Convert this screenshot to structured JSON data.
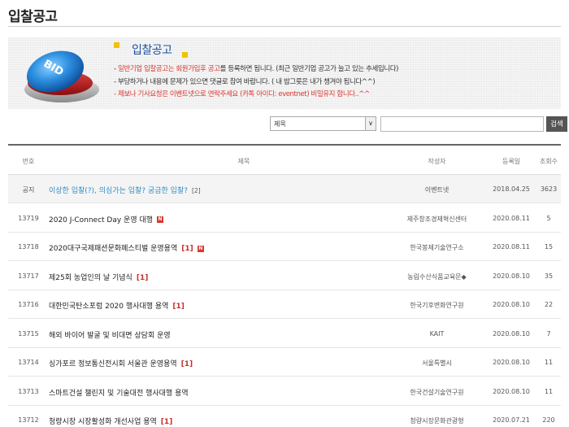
{
  "page": {
    "title": "입찰공고"
  },
  "banner": {
    "title": "입찰공고",
    "art_text": "BID",
    "line1": {
      "prefix": "- ",
      "highlight": "일반기업 입찰공고는 회원가입후 공고",
      "rest": "를 등록하면 됩니다. (최근 일반기업 공고가 늘고 있는 추세입니다)"
    },
    "line2": "- 부당하거나 내용에 문제가 있으면 댓글로 참여 바랍니다. ( 내 밥그릇은 내가 챙겨야 됩니다^^)",
    "line3": "- 제보나 기사요청은 이벤트넷으로 연락주세요 (카톡 아이디: eventnet) 비밀유지 합니다..^^"
  },
  "search": {
    "select_value": "제목",
    "arrow": "∨",
    "input_value": "",
    "button_label": "검색"
  },
  "table": {
    "headers": {
      "no": "번호",
      "title": "제목",
      "writer": "작성자",
      "date": "등록일",
      "views": "조회수"
    },
    "notice": {
      "no": "공지",
      "title": "이상한 입찰(?), 의심가는 입찰? 궁금한 입찰?",
      "comments": "[2]",
      "writer": "이벤트넷",
      "date": "2018.04.25",
      "views": "3623"
    },
    "rows": [
      {
        "no": "13719",
        "title": "2020 J-Connect Day 운영 대행",
        "comments": "",
        "new": "N",
        "writer": "제주창조경제혁신센터",
        "date": "2020.08.11",
        "views": "5"
      },
      {
        "no": "13718",
        "title": "2020대구국제패션문화페스티벌 운영용역",
        "comments": "[1]",
        "new": "N",
        "writer": "한국봉제기술연구소",
        "date": "2020.08.11",
        "views": "15"
      },
      {
        "no": "13717",
        "title": "제25회 농업인의 날 기념식",
        "comments": "[1]",
        "new": "",
        "writer": "농림수산식품교육문◆",
        "date": "2020.08.10",
        "views": "35"
      },
      {
        "no": "13716",
        "title": "대한민국탄소포럼 2020 행사대행 용역",
        "comments": "[1]",
        "new": "",
        "writer": "한국기후변화연구원",
        "date": "2020.08.10",
        "views": "22"
      },
      {
        "no": "13715",
        "title": "해외 바이어 발굴 및 비대면 상담회 운영",
        "comments": "",
        "new": "",
        "writer": "KAIT",
        "date": "2020.08.10",
        "views": "7"
      },
      {
        "no": "13714",
        "title": "싱가포르 정보통신전시회 서울관 운영용역",
        "comments": "[1]",
        "new": "",
        "writer": "서울특별시",
        "date": "2020.08.10",
        "views": "11"
      },
      {
        "no": "13713",
        "title": "스마트건설 챌린지 및 기술대전 행사대행 용역",
        "comments": "",
        "new": "",
        "writer": "한국건설기술연구원",
        "date": "2020.08.10",
        "views": "11"
      },
      {
        "no": "13712",
        "title": "청량시장 시장활성화 개선사업 용역",
        "comments": "[1]",
        "new": "",
        "writer": "청량시장문화관광형",
        "date": "2020.07.21",
        "views": "220"
      }
    ]
  }
}
